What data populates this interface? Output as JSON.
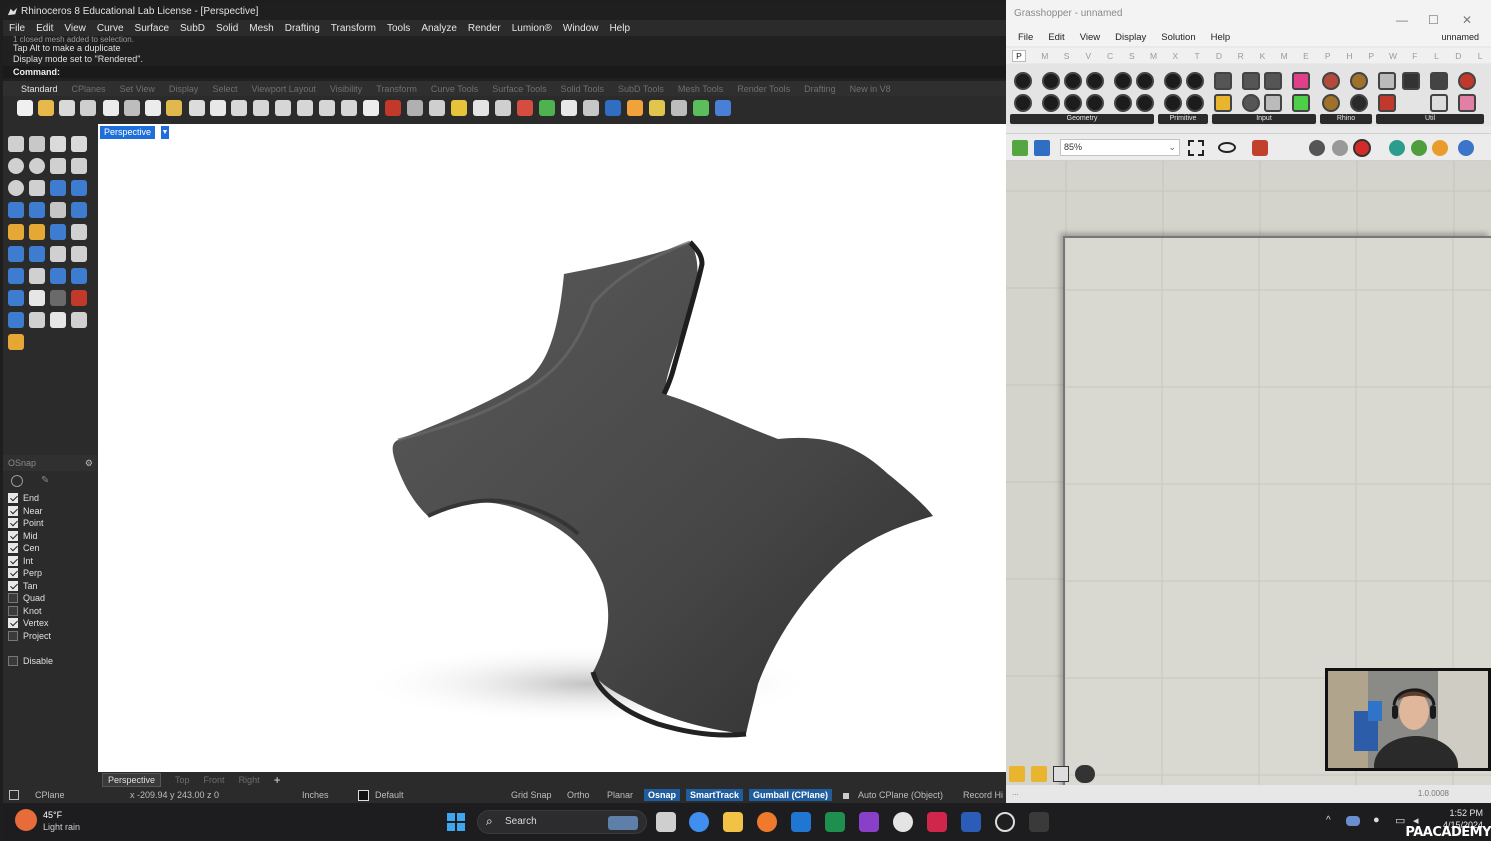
{
  "rhino": {
    "title": "Rhinoceros 8 Educational Lab License - [Perspective]",
    "menu": [
      "File",
      "Edit",
      "View",
      "Curve",
      "Surface",
      "SubD",
      "Solid",
      "Mesh",
      "Drafting",
      "Transform",
      "Tools",
      "Analyze",
      "Render",
      "Lumion®",
      "Window",
      "Help"
    ],
    "command_history": [
      "1 closed mesh added to selection.",
      "Tap Alt to make a duplicate",
      "Display mode set to \"Rendered\"."
    ],
    "command_prompt": "Command:",
    "toolbar_tabs": [
      "Standard",
      "CPlanes",
      "Set View",
      "Display",
      "Select",
      "Viewport Layout",
      "Visibility",
      "Transform",
      "Curve Tools",
      "Surface Tools",
      "Solid Tools",
      "SubD Tools",
      "Mesh Tools",
      "Render Tools",
      "Drafting",
      "New in V8"
    ],
    "active_toolbar_tab": "Standard",
    "osnap": {
      "header": "OSnap",
      "items": [
        {
          "label": "End",
          "checked": true
        },
        {
          "label": "Near",
          "checked": true
        },
        {
          "label": "Point",
          "checked": true
        },
        {
          "label": "Mid",
          "checked": true
        },
        {
          "label": "Cen",
          "checked": true
        },
        {
          "label": "Int",
          "checked": true
        },
        {
          "label": "Perp",
          "checked": true
        },
        {
          "label": "Tan",
          "checked": true
        },
        {
          "label": "Quad",
          "checked": false
        },
        {
          "label": "Knot",
          "checked": false
        },
        {
          "label": "Vertex",
          "checked": true
        },
        {
          "label": "Project",
          "checked": false
        }
      ],
      "disable_label": "Disable",
      "disable_checked": false
    },
    "viewport_label": "Perspective",
    "viewport_tabs": [
      "Perspective",
      "Top",
      "Front",
      "Right"
    ],
    "active_viewport_tab": "Perspective",
    "status": {
      "cplane": "CPlane",
      "coords": "x -209.94  y 243.00  z 0",
      "units": "Inches",
      "layer": "Default",
      "grid_snap": "Grid Snap",
      "ortho": "Ortho",
      "planar": "Planar",
      "osnap": "Osnap",
      "smarttrack": "SmartTrack",
      "gumball": "Gumball (CPlane)",
      "auto_cplane": "Auto CPlane (Object)",
      "record_history": "Record Hi"
    }
  },
  "grasshopper": {
    "title": "Grasshopper - unnamed",
    "menu": [
      "File",
      "Edit",
      "View",
      "Display",
      "Solution",
      "Help"
    ],
    "doc_name": "unnamed",
    "category_tabs": [
      "P",
      "M",
      "S",
      "V",
      "C",
      "S",
      "M",
      "X",
      "T",
      "D",
      "R",
      "K",
      "M",
      "E",
      "P",
      "H",
      "P",
      "W",
      "F",
      "L",
      "D",
      "L"
    ],
    "groups": [
      "Geometry",
      "Primitive",
      "Input",
      "Rhino",
      "Util"
    ],
    "zoom": "85%",
    "version": "1.0.0008"
  },
  "taskbar": {
    "weather_temp": "45°F",
    "weather_desc": "Light rain",
    "search_label": "Search",
    "time": "1:52 PM",
    "date": "4/15/2024",
    "brand": "PAACADEMY"
  },
  "colors": {
    "rhino_bg": "#2b2b2b",
    "viewport_bg": "#ffffff",
    "surface_gray": "#4a4a4a",
    "accent_blue": "#1e6fd9",
    "gh_canvas": "#d4d4cc"
  }
}
